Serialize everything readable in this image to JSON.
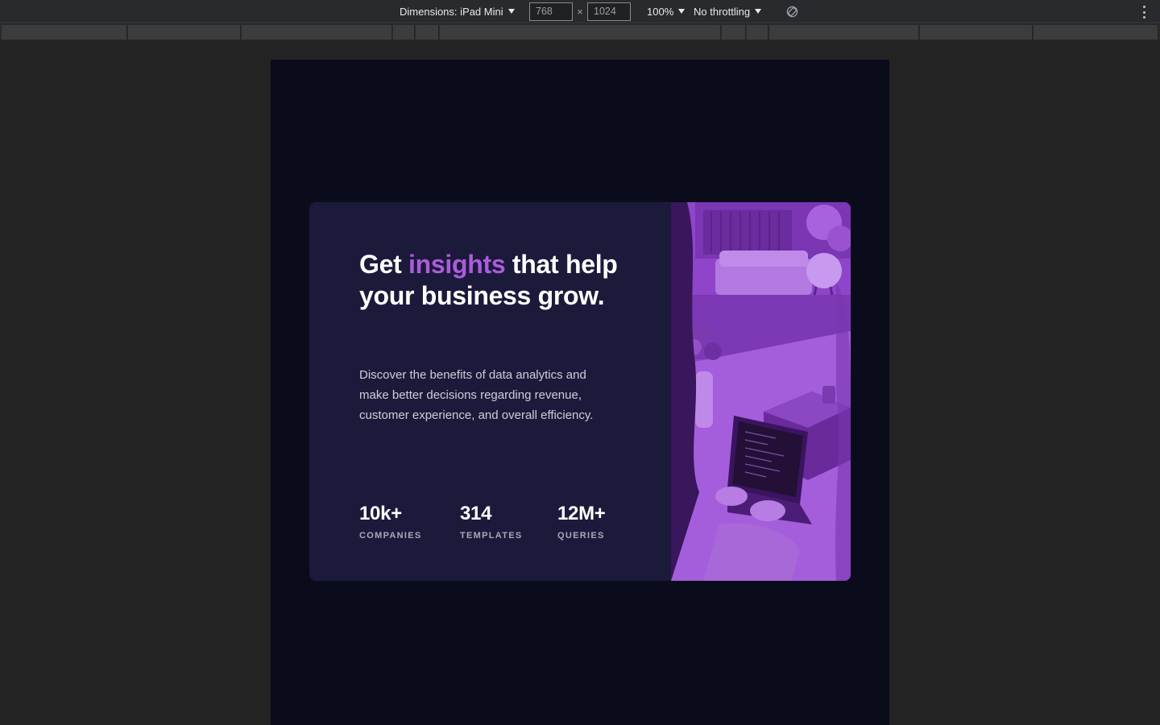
{
  "devtools": {
    "device_label": "Dimensions: iPad Mini",
    "width_value": "768",
    "height_value": "1024",
    "times_symbol": "×",
    "zoom": "100%",
    "throttling": "No throttling"
  },
  "card": {
    "headline_part1": "Get ",
    "headline_accent": "insights",
    "headline_part2": " that help your business grow.",
    "description": "Discover the benefits of data analytics and make better decisions regarding revenue, customer experience, and overall efficiency.",
    "stats": [
      {
        "value": "10k+",
        "label": "COMPANIES"
      },
      {
        "value": "314",
        "label": "TEMPLATES"
      },
      {
        "value": "12M+",
        "label": "QUERIES"
      }
    ]
  },
  "colors": {
    "page_bg": "#0a0c1c",
    "card_bg": "#1c1a3b",
    "accent": "#ab5cdb",
    "image_overlay": "#9b4fd6"
  }
}
